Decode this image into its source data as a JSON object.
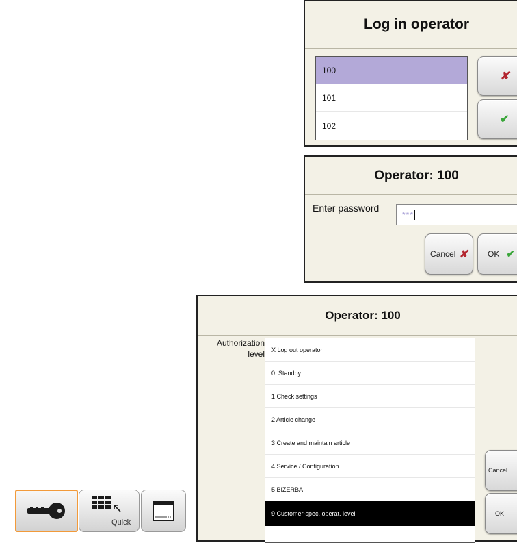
{
  "login_panel": {
    "title": "Log in operator",
    "operators": [
      "100",
      "101",
      "102"
    ],
    "selected_index": 0,
    "cancel_icon": "cross-icon",
    "confirm_icon": "check-icon"
  },
  "password_panel": {
    "title": "Operator: 100",
    "label": "Enter password",
    "value": "***",
    "cancel_label": "Cancel",
    "ok_label": "OK"
  },
  "auth_panel": {
    "title": "Operator: 100",
    "label_line1": "Authorization",
    "label_line2": "level",
    "levels": [
      "X Log out operator",
      "0: Standby",
      "1 Check settings",
      "2 Article change",
      "3 Create and maintain article",
      "4 Service / Configuration",
      "5 BIZERBA",
      "9 Customer-spec. operat. level"
    ],
    "selected_index": 7,
    "cancel_label": "Cancel",
    "ok_label": "OK"
  },
  "toolbar": {
    "key_icon": "key-icon",
    "quick_label": "Quick",
    "quick_icon": "keypad-icon",
    "screen_icon": "screen-icon"
  },
  "colors": {
    "panel_bg": "#f3f1e6",
    "selected_row": "#b3a9d8",
    "selected_row_dark": "#000000",
    "active_tool": "#f29a3a"
  }
}
